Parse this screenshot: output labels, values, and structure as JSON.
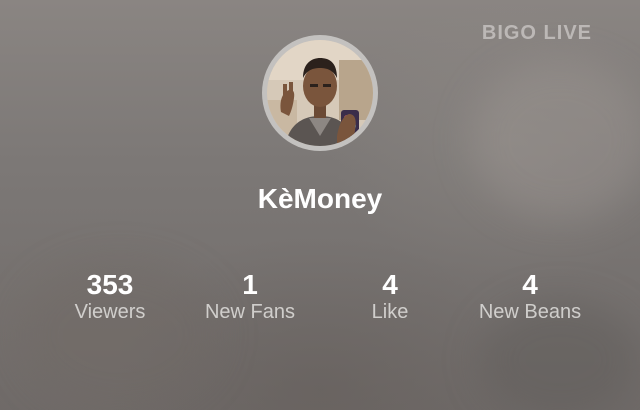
{
  "brand": {
    "label": "BIGO LIVE"
  },
  "profile": {
    "username": "KèMoney"
  },
  "stats": [
    {
      "value": "353",
      "label": "Viewers"
    },
    {
      "value": "1",
      "label": "New Fans"
    },
    {
      "value": "4",
      "label": "Like"
    },
    {
      "value": "4",
      "label": "New Beans"
    }
  ]
}
